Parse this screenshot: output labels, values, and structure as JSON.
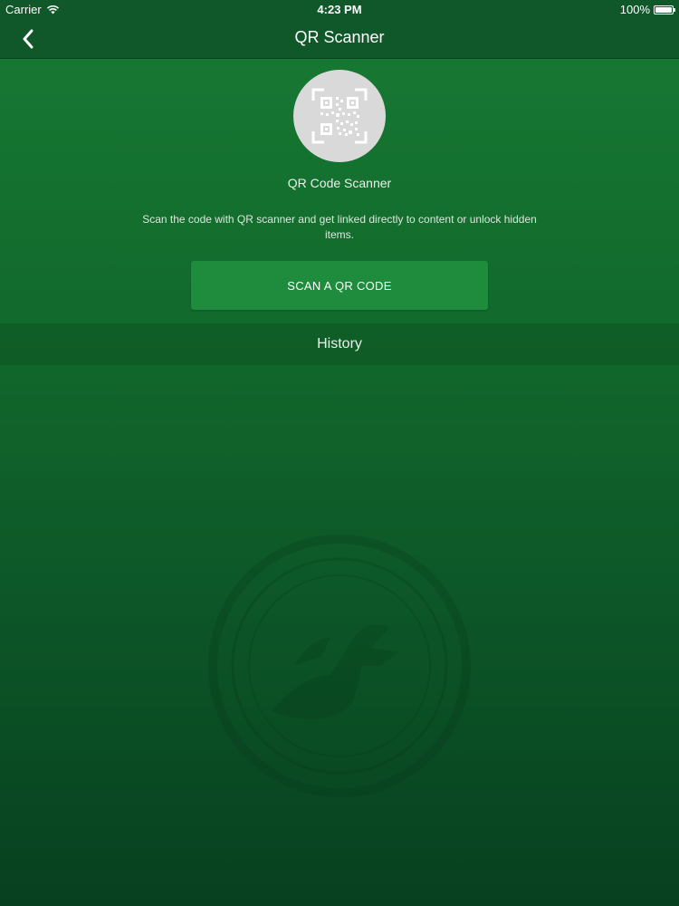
{
  "status_bar": {
    "carrier": "Carrier",
    "time": "4:23 PM",
    "battery": "100%"
  },
  "nav": {
    "title": "QR Scanner",
    "back_icon": "chevron-left-icon"
  },
  "main": {
    "qr_icon": "qr-code-icon",
    "title": "QR Code Scanner",
    "description": "Scan the code with QR scanner and get linked directly to content or unlock hidden items.",
    "scan_button": "SCAN A QR CODE"
  },
  "history": {
    "label": "History"
  },
  "colors": {
    "background_top": "#177a34",
    "background_bottom": "#07401f",
    "bar": "#10582a",
    "button": "#1f8b3c",
    "qr_circle": "#d9d9d9"
  }
}
